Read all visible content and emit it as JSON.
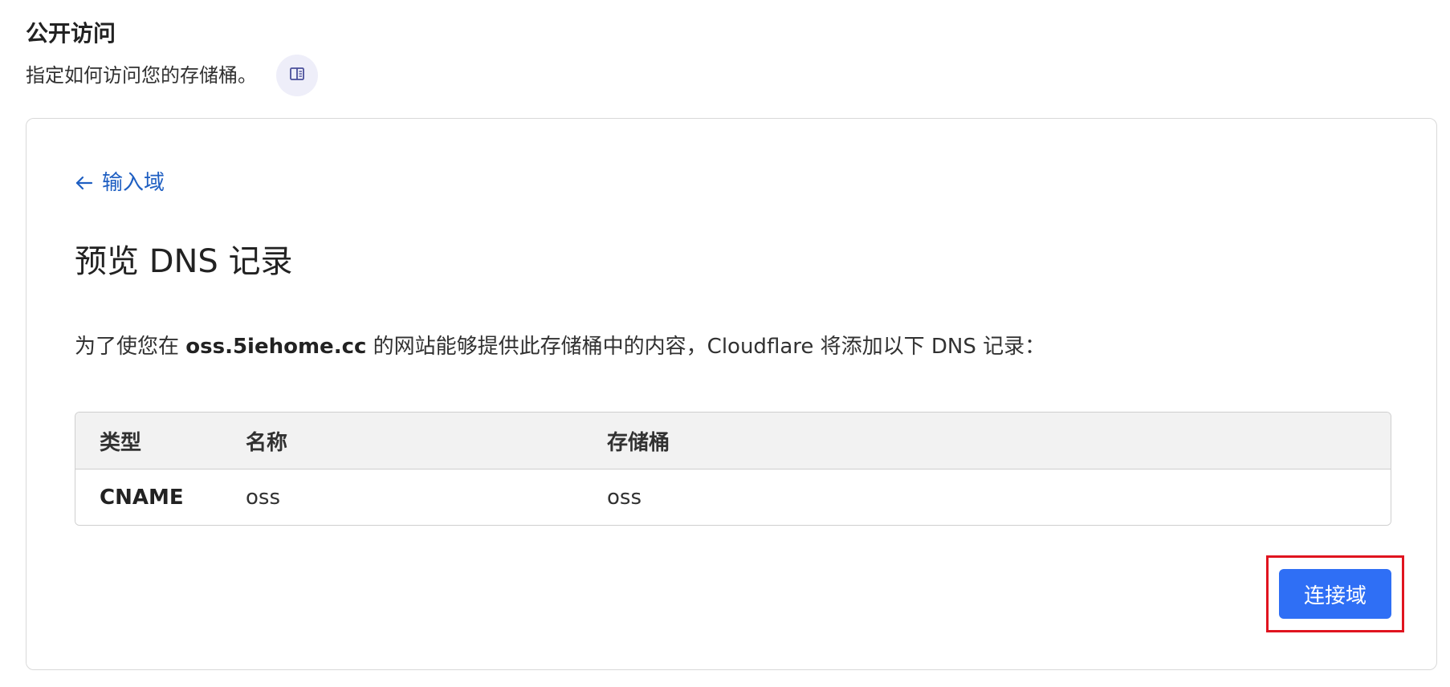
{
  "section": {
    "title": "公开访问",
    "description": "指定如何访问您的存储桶。",
    "docs_icon": "book-icon"
  },
  "card": {
    "back_link": {
      "icon": "arrow-left-icon",
      "label": "输入域"
    },
    "title": "预览 DNS 记录",
    "description": {
      "prefix": "为了使您在 ",
      "domain": "oss.5iehome.cc",
      "suffix": " 的网站能够提供此存储桶中的内容，Cloudflare 将添加以下 DNS 记录："
    },
    "table": {
      "headers": {
        "type": "类型",
        "name": "名称",
        "bucket": "存储桶"
      },
      "rows": [
        {
          "type": "CNAME",
          "name": "oss",
          "bucket": "oss"
        }
      ]
    },
    "connect_button": "连接域"
  },
  "colors": {
    "link": "#1f5fc2",
    "primary_button": "#2f6ff5",
    "highlight_border": "#e0141f",
    "table_header_bg": "#f2f2f2"
  }
}
